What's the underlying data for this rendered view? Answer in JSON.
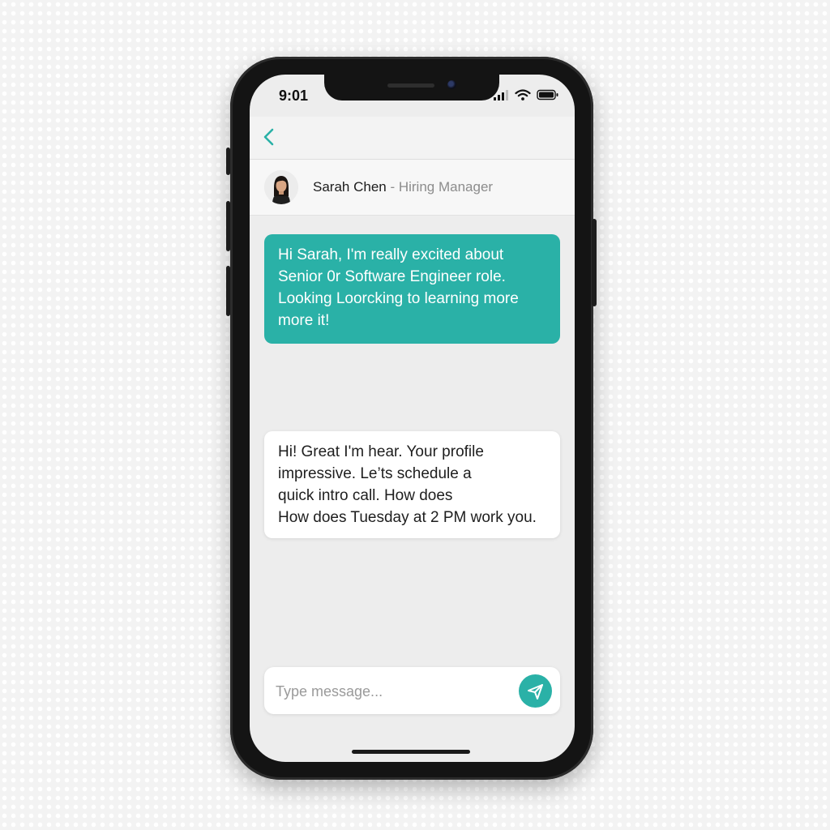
{
  "status_bar": {
    "time": "9:01",
    "icons": [
      "signal-icon",
      "wifi-icon",
      "battery-icon"
    ]
  },
  "nav": {
    "back_icon": "chevron-left-icon"
  },
  "contact": {
    "name": "Sarah Chen",
    "separator": " - ",
    "role": "Hiring Manager",
    "avatar_icon": "person-avatar"
  },
  "messages": [
    {
      "direction": "outgoing",
      "lines": [
        "Hi Sarah, I'm really excited about",
        "Senior 0r Software Engineer role.",
        "Looking Loorcking to learning more",
        "more it!"
      ]
    },
    {
      "direction": "incoming",
      "lines": [
        "Hi! Great I'm hear. Your profile",
        "impressive. Le’ts schedule a",
        "quick intro call. How does",
        "How does Tuesday at 2 PM work you."
      ]
    }
  ],
  "composer": {
    "placeholder": "Type message...",
    "value": "",
    "send_icon": "send-icon"
  },
  "colors": {
    "accent": "#2ab1a7",
    "incoming_bubble": "#ffffff",
    "screen_background": "#ededed",
    "phone_frame": "#141414"
  }
}
